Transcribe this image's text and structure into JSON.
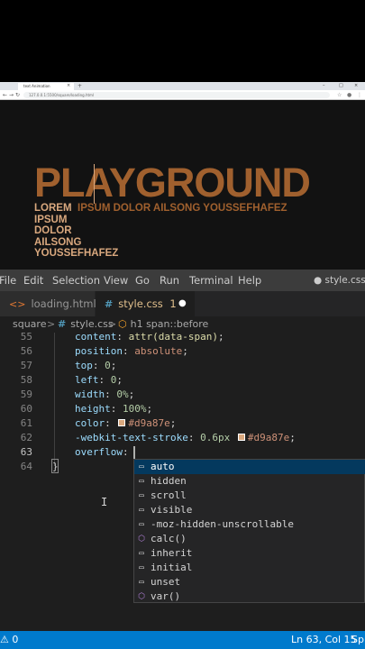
{
  "browser": {
    "tab_title": "text Animation",
    "tab_close": "×",
    "new_tab": "+",
    "url": "127.0.0.1:5500/square/loading.html",
    "nav": {
      "back": "←",
      "forward": "→",
      "reload": "↻"
    },
    "window_controls": {
      "minimize": "–",
      "maximize": "□",
      "close": "×"
    }
  },
  "page": {
    "title": "PLAYGROUND",
    "subtitle": "IPSUM DOLOR AILSONG YOUSSEFHAFEZ",
    "words": [
      "LOREM",
      "IPSUM",
      "DOLOR",
      "AILSONG",
      "YOUSSEFHAFEZ"
    ],
    "colors": {
      "title": "#a0602e",
      "words": "#d9a87e"
    }
  },
  "vscode": {
    "menu": [
      "File",
      "Edit",
      "Selection",
      "View",
      "Go",
      "Run",
      "Terminal",
      "Help"
    ],
    "window_title": "● style.css - H",
    "tabs": [
      {
        "label": "loading.html",
        "icon": "html-icon"
      },
      {
        "label": "style.css",
        "badge": "1",
        "icon": "css-icon"
      }
    ],
    "breadcrumbs": [
      "square",
      "style.css",
      "h1 span::before"
    ],
    "breadcrumb_sep": ">",
    "code": {
      "line_numbers": [
        "55",
        "56",
        "57",
        "58",
        "59",
        "60",
        "61",
        "62",
        "63",
        "64"
      ],
      "lines": [
        {
          "prop": "content",
          "value": "attr(data-span)"
        },
        {
          "prop": "position",
          "value": "absolute"
        },
        {
          "prop": "top",
          "value": "0"
        },
        {
          "prop": "left",
          "value": "0"
        },
        {
          "prop": "width",
          "value": "0%"
        },
        {
          "prop": "height",
          "value": "100%"
        },
        {
          "prop": "color",
          "value": "#d9a87e"
        },
        {
          "prop": "-webkit-text-stroke",
          "value": "0.6px",
          "value2": "#d9a87e"
        },
        {
          "prop": "overflow",
          "value": ""
        }
      ],
      "closing_brace": "}"
    },
    "suggestions": [
      {
        "label": "auto",
        "kind": "keyword",
        "selected": true
      },
      {
        "label": "hidden",
        "kind": "keyword"
      },
      {
        "label": "scroll",
        "kind": "keyword"
      },
      {
        "label": "visible",
        "kind": "keyword"
      },
      {
        "label": "-moz-hidden-unscrollable",
        "kind": "keyword"
      },
      {
        "label": "calc()",
        "kind": "function"
      },
      {
        "label": "inherit",
        "kind": "keyword"
      },
      {
        "label": "initial",
        "kind": "keyword"
      },
      {
        "label": "unset",
        "kind": "keyword"
      },
      {
        "label": "var()",
        "kind": "function"
      }
    ],
    "status": {
      "problems": "⚠ 0",
      "position": "Ln 63, Col 15",
      "spaces": "Sp"
    }
  }
}
